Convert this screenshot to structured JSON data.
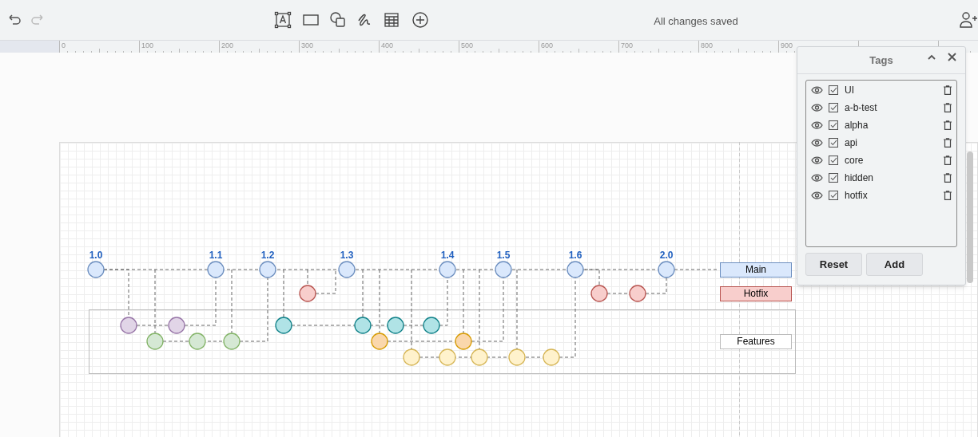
{
  "toolbar": {
    "status": "All changes saved"
  },
  "ruler": {
    "ticks": [
      "0",
      "100",
      "200",
      "300",
      "400",
      "500",
      "600",
      "700",
      "800",
      "900"
    ]
  },
  "diagram": {
    "versions": [
      "1.0",
      "1.1",
      "1.2",
      "1.3",
      "1.4",
      "1.5",
      "1.6",
      "2.0"
    ],
    "lanes": [
      {
        "label": "Main",
        "color": "#dae8fc"
      },
      {
        "label": "Hotfix",
        "color": "#f8cecc"
      },
      {
        "label": "Features",
        "color": "#ffffff"
      }
    ]
  },
  "tags_panel": {
    "title": "Tags",
    "tags": [
      {
        "name": "UI",
        "checked": true
      },
      {
        "name": "a-b-test",
        "checked": true
      },
      {
        "name": "alpha",
        "checked": true
      },
      {
        "name": "api",
        "checked": true
      },
      {
        "name": "core",
        "checked": true
      },
      {
        "name": "hidden",
        "checked": true
      },
      {
        "name": "hotfix",
        "checked": true
      }
    ],
    "buttons": [
      "Reset",
      "Add"
    ]
  }
}
